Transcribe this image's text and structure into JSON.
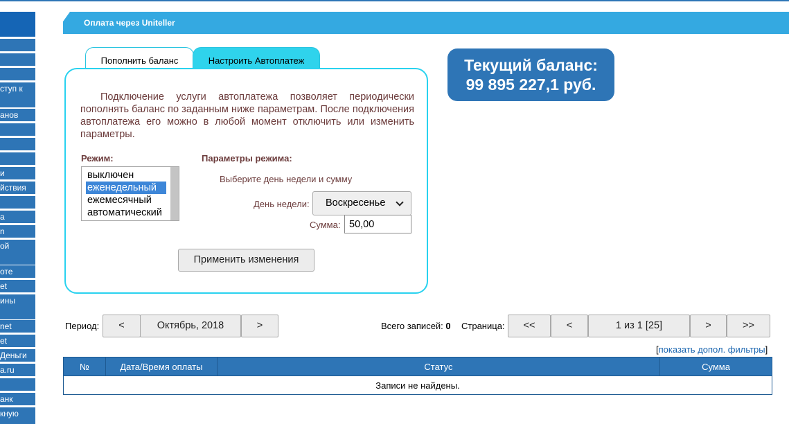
{
  "sidebar": {
    "items": [
      {
        "label": ""
      },
      {
        "label": ""
      },
      {
        "label": ""
      },
      {
        "label": "ступ к"
      },
      {
        "label": "анов"
      },
      {
        "label": ""
      },
      {
        "label": ""
      },
      {
        "label": ""
      },
      {
        "label": "и"
      },
      {
        "label": "йствия"
      },
      {
        "label": ""
      },
      {
        "label": "а"
      },
      {
        "label": "n"
      },
      {
        "label": "ой"
      },
      {
        "label": "оте"
      },
      {
        "label": "et"
      },
      {
        "label": "ины"
      },
      {
        "label": "net"
      },
      {
        "label": "et"
      },
      {
        "label": "Деньги"
      },
      {
        "label": "a.ru"
      },
      {
        "label": ""
      },
      {
        "label": "анк"
      },
      {
        "label": "кную"
      }
    ]
  },
  "header": {
    "title": "Оплата через Uniteller"
  },
  "tabs": {
    "topup": "Пополнить баланс",
    "autopay": "Настроить Автоплатеж"
  },
  "panel": {
    "description": "Подключение услуги автоплатежа позволяет периодически пополнять баланс по заданным ниже параметрам. После подключения автоплатежа его можно в любой момент отключить или изменить параметры.",
    "mode_label": "Режим:",
    "params_label": "Параметры режима:",
    "modes": [
      "выключен",
      "еженедельный",
      "ежемесячный",
      "автоматический"
    ],
    "selected_mode": "еженедельный",
    "hint": "Выберите день недели и сумму",
    "day_label": "День недели:",
    "day_value": "Воскресенье",
    "sum_label": "Сумма:",
    "sum_value": "50,00",
    "apply_label": "Применить изменения"
  },
  "balance": {
    "line1": "Текущий баланс:",
    "line2": "99 895 227,1 руб."
  },
  "period": {
    "label": "Период:",
    "prev": "<",
    "value": "Октябрь, 2018",
    "next": ">"
  },
  "pager": {
    "total_label": "Всего записей:",
    "total_value": "0",
    "page_label": "Страница:",
    "first": "<<",
    "prev": "<",
    "current": "1 из 1 [25]",
    "next": ">",
    "last": ">>"
  },
  "filters": {
    "open": "[",
    "link": "показать допол. фильтры",
    "close": "]"
  },
  "table": {
    "headers": [
      "№",
      "Дата/Время оплаты",
      "Статус",
      "Сумма"
    ],
    "empty": "Записи не найдены."
  },
  "colors": {
    "accent": "#2e75b6",
    "header": "#34a9e1",
    "tab_active": "#2fd3ec",
    "panel_border": "#29d2ef"
  }
}
